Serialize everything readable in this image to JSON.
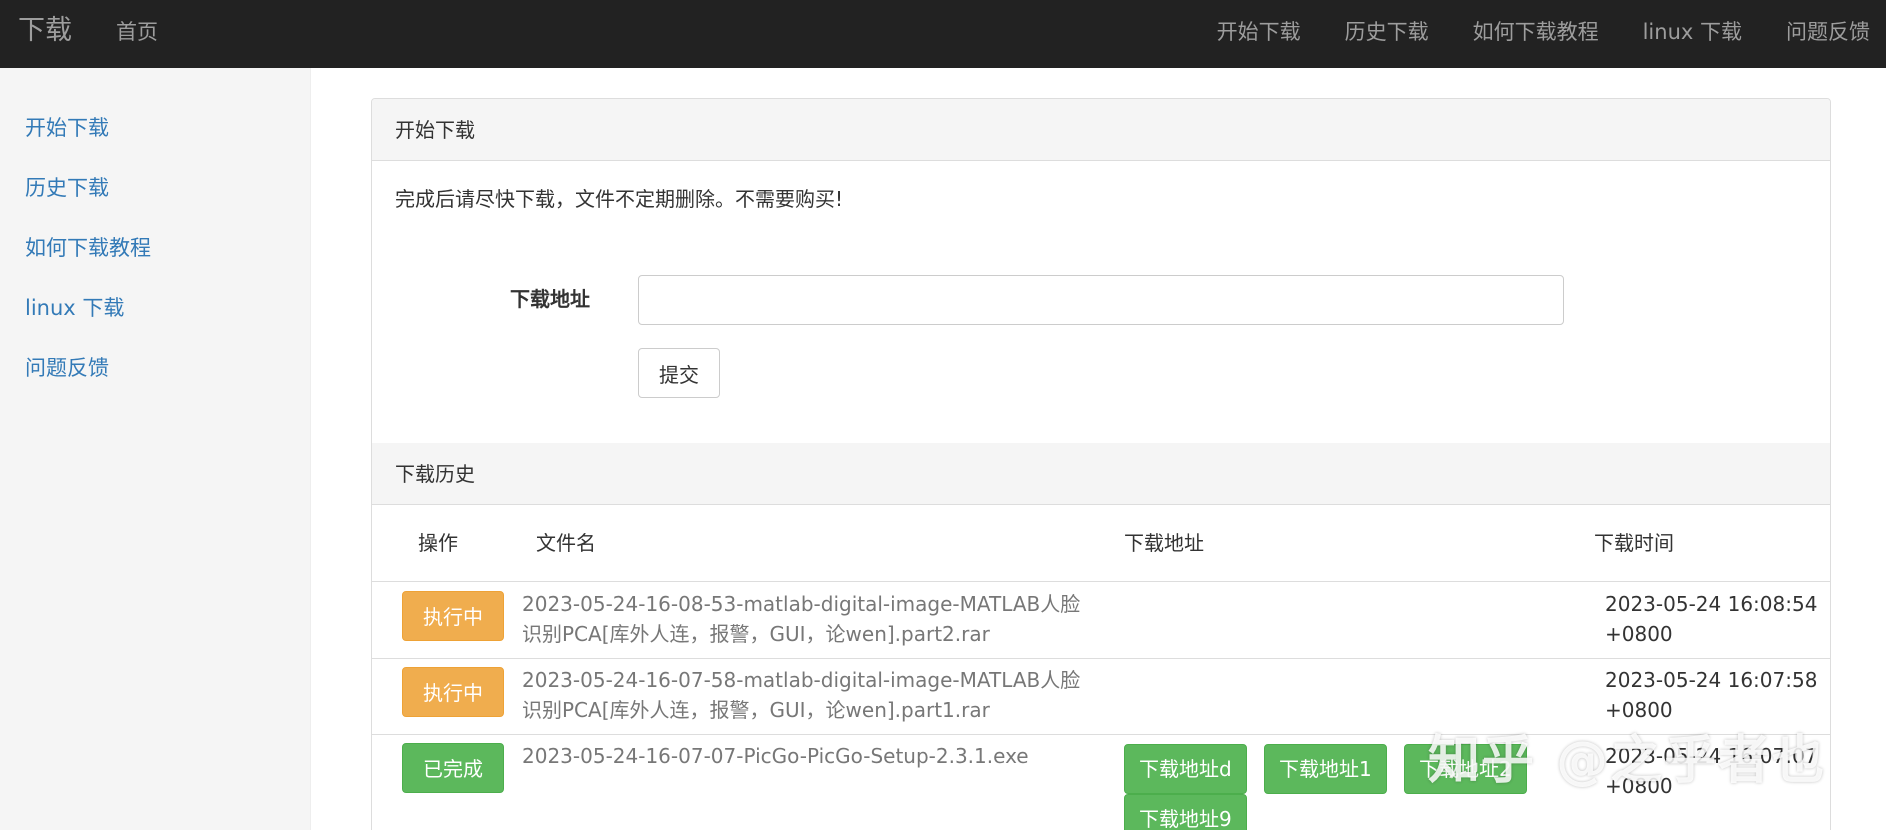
{
  "navbar": {
    "brand": "下载",
    "home": "首页",
    "links": [
      "开始下载",
      "历史下载",
      "如何下载教程",
      "linux 下载",
      "问题反馈"
    ]
  },
  "sidebar": {
    "items": [
      "开始下载",
      "历史下载",
      "如何下载教程",
      "linux 下载",
      "问题反馈"
    ]
  },
  "start_panel": {
    "title": "开始下载",
    "notice": "完成后请尽快下载，文件不定期删除。不需要购买!",
    "url_label": "下载地址",
    "url_value": "",
    "submit_label": "提交"
  },
  "history": {
    "title": "下载历史",
    "columns": [
      "操作",
      "文件名",
      "下载地址",
      "下载时间"
    ],
    "rows": [
      {
        "status": "执行中",
        "status_color": "#f0ad4e",
        "filename": "2023-05-24-16-08-53-matlab-digital-image-MATLAB人脸识别PCA[库外人连，报警，GUI，论wen].part2.rar",
        "time": "2023-05-24 16:08:54 +0800"
      },
      {
        "status": "执行中",
        "status_color": "#f0ad4e",
        "filename": "2023-05-24-16-07-58-matlab-digital-image-MATLAB人脸识别PCA[库外人连，报警，GUI，论wen].part1.rar",
        "time": "2023-05-24 16:07:58 +0800"
      },
      {
        "status": "已完成",
        "status_color": "#5cb85c",
        "filename": "2023-05-24-16-07-07-PicGo-PicGo-Setup-2.3.1.exe",
        "links": [
          "下载地址d",
          "下载地址1",
          "下载地址2",
          "下载地址9"
        ],
        "time": "2023-05-24 16:07:07 +0800"
      }
    ]
  },
  "watermark": "知乎 @之乎者也"
}
